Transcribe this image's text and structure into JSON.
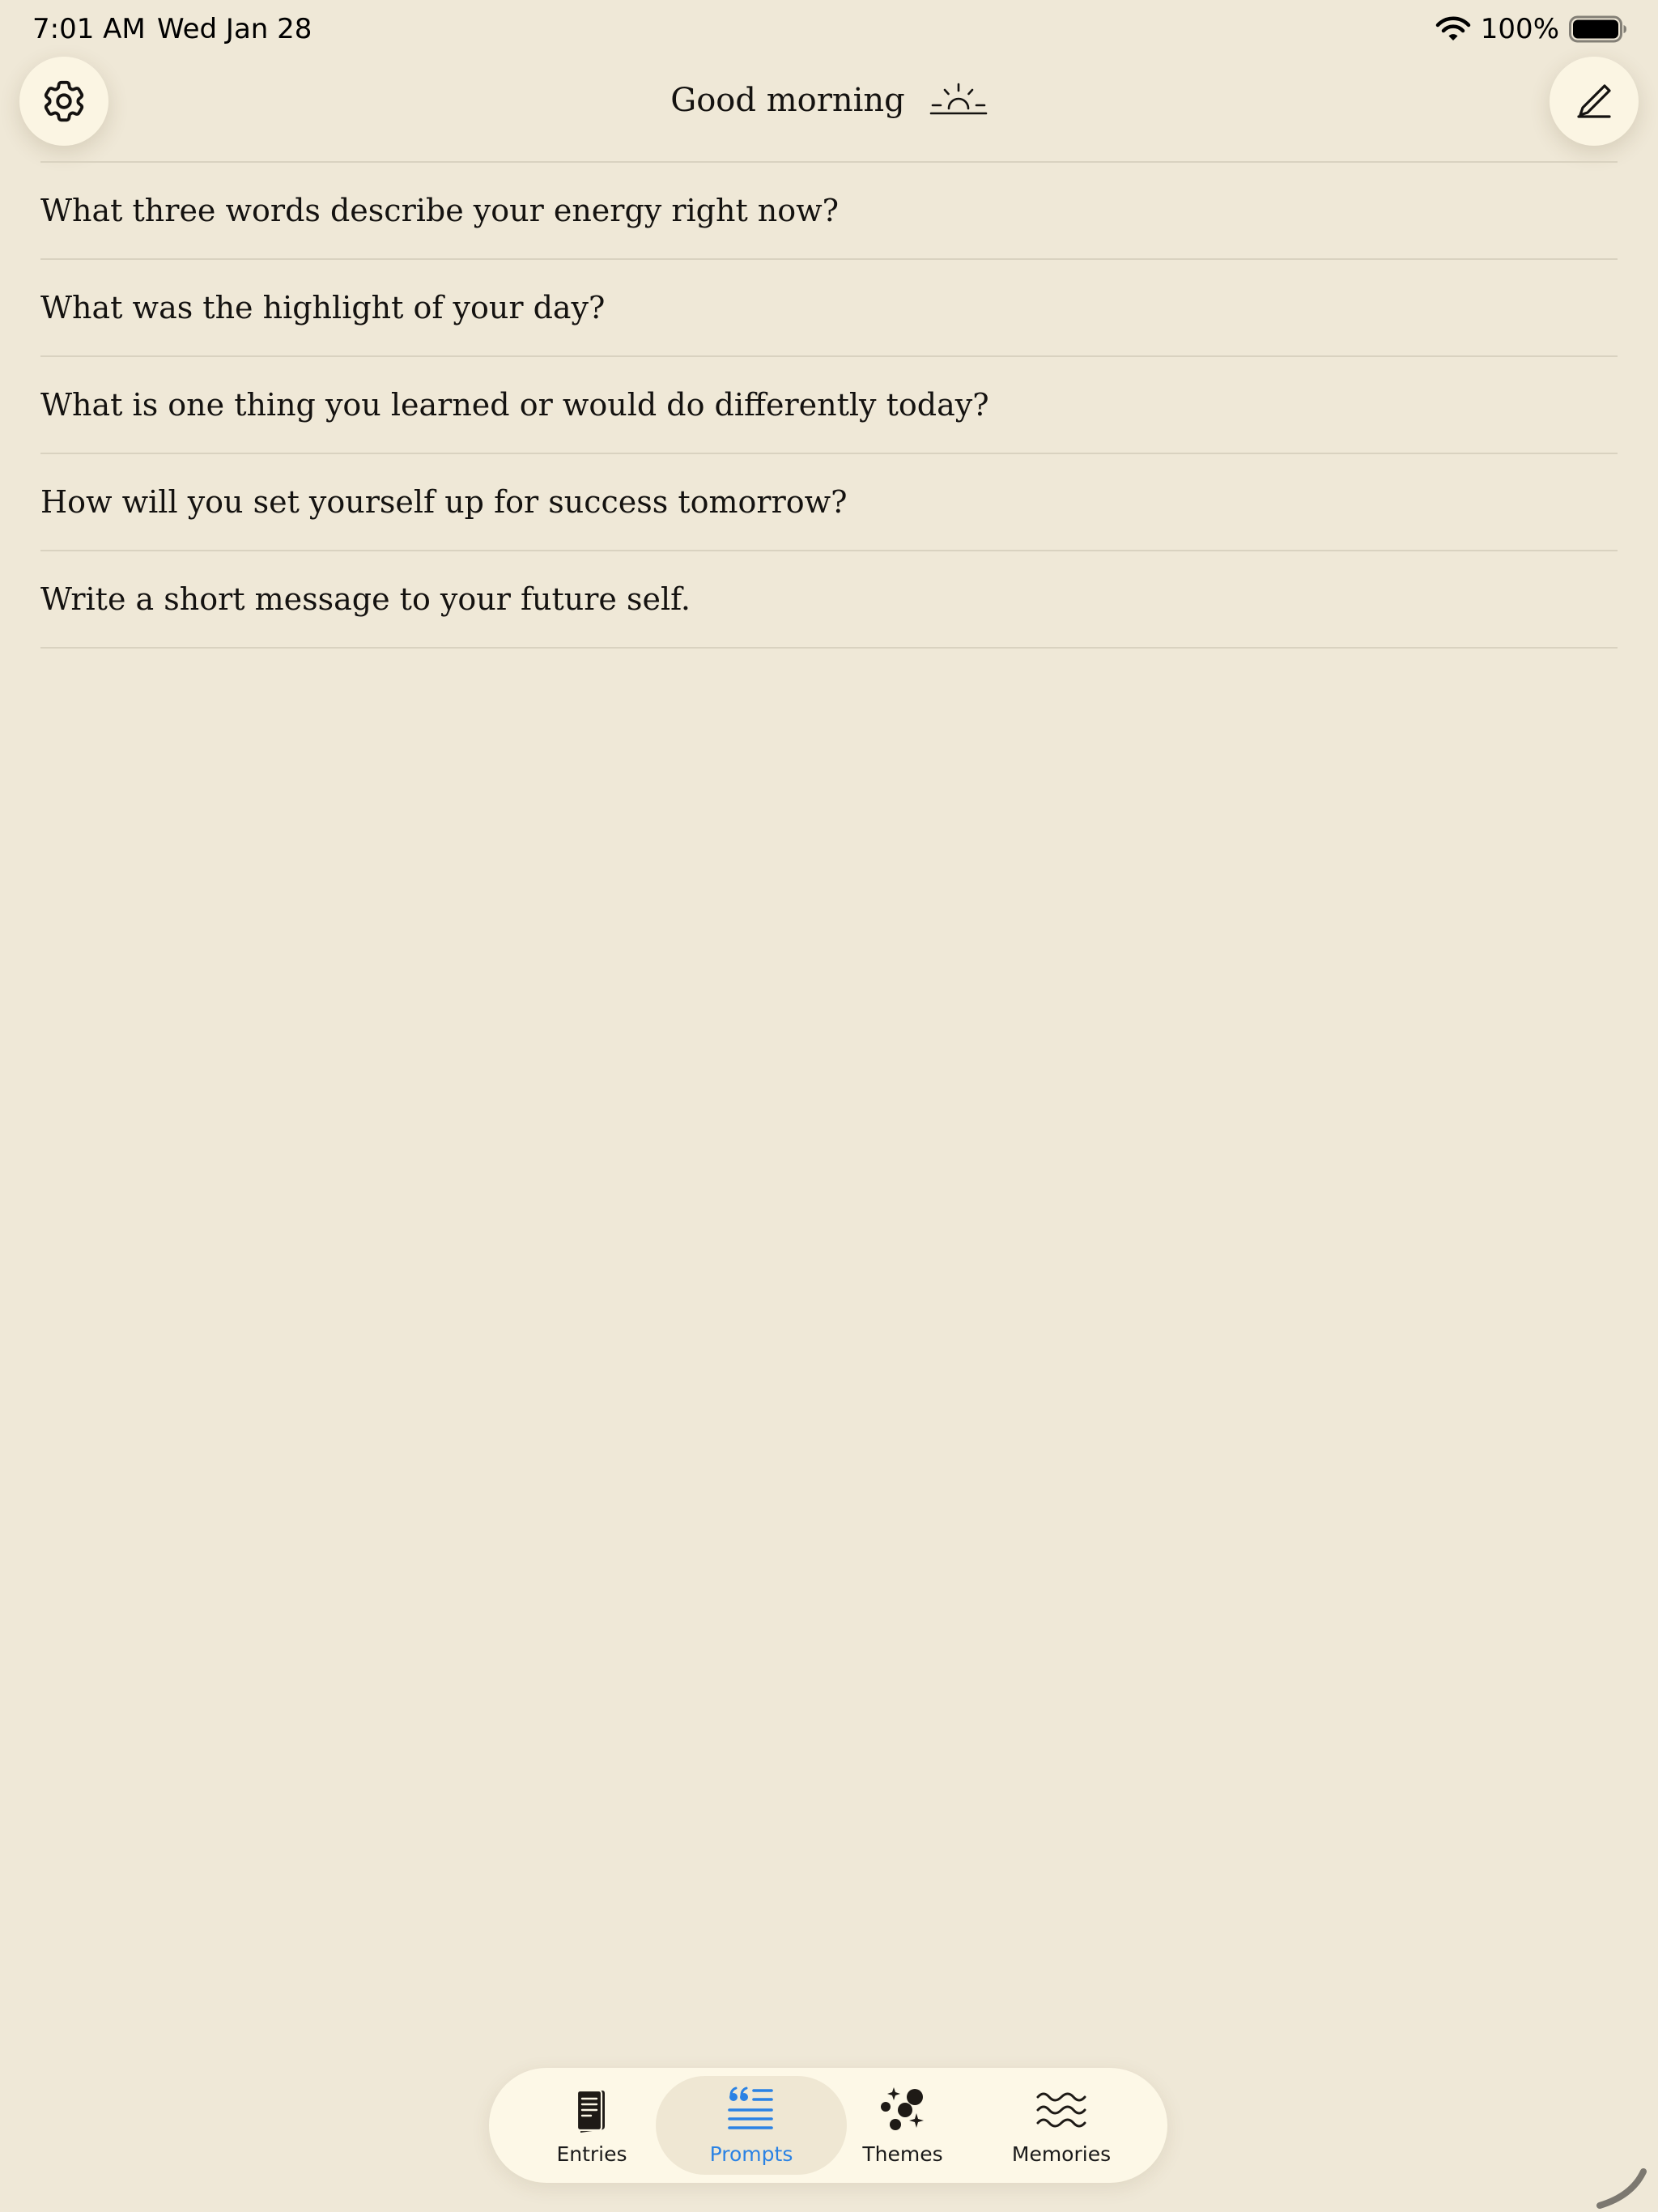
{
  "status_bar": {
    "time": "7:01 AM",
    "date": "Wed Jan 28",
    "battery": "100%"
  },
  "header": {
    "greeting": "Good morning",
    "settings_icon": "gear-icon",
    "compose_icon": "pencil-icon",
    "greeting_icon": "sunrise-icon"
  },
  "prompts": [
    "What three words describe your energy right now?",
    "What was the highlight of your day?",
    "What is one thing you learned or would do differently today?",
    "How will you set yourself up for success tomorrow?",
    "Write a short message to your future self."
  ],
  "tabs": [
    {
      "label": "Entries",
      "icon": "journal-icon",
      "selected": false
    },
    {
      "label": "Prompts",
      "icon": "quote-list-icon",
      "selected": true
    },
    {
      "label": "Themes",
      "icon": "sparkle-bubbles-icon",
      "selected": false
    },
    {
      "label": "Memories",
      "icon": "waves-icon",
      "selected": false
    }
  ],
  "colors": {
    "background": "#EFE8D7",
    "accent": "#2A82E4",
    "text": "#141210",
    "divider": "#D9D2C0"
  }
}
